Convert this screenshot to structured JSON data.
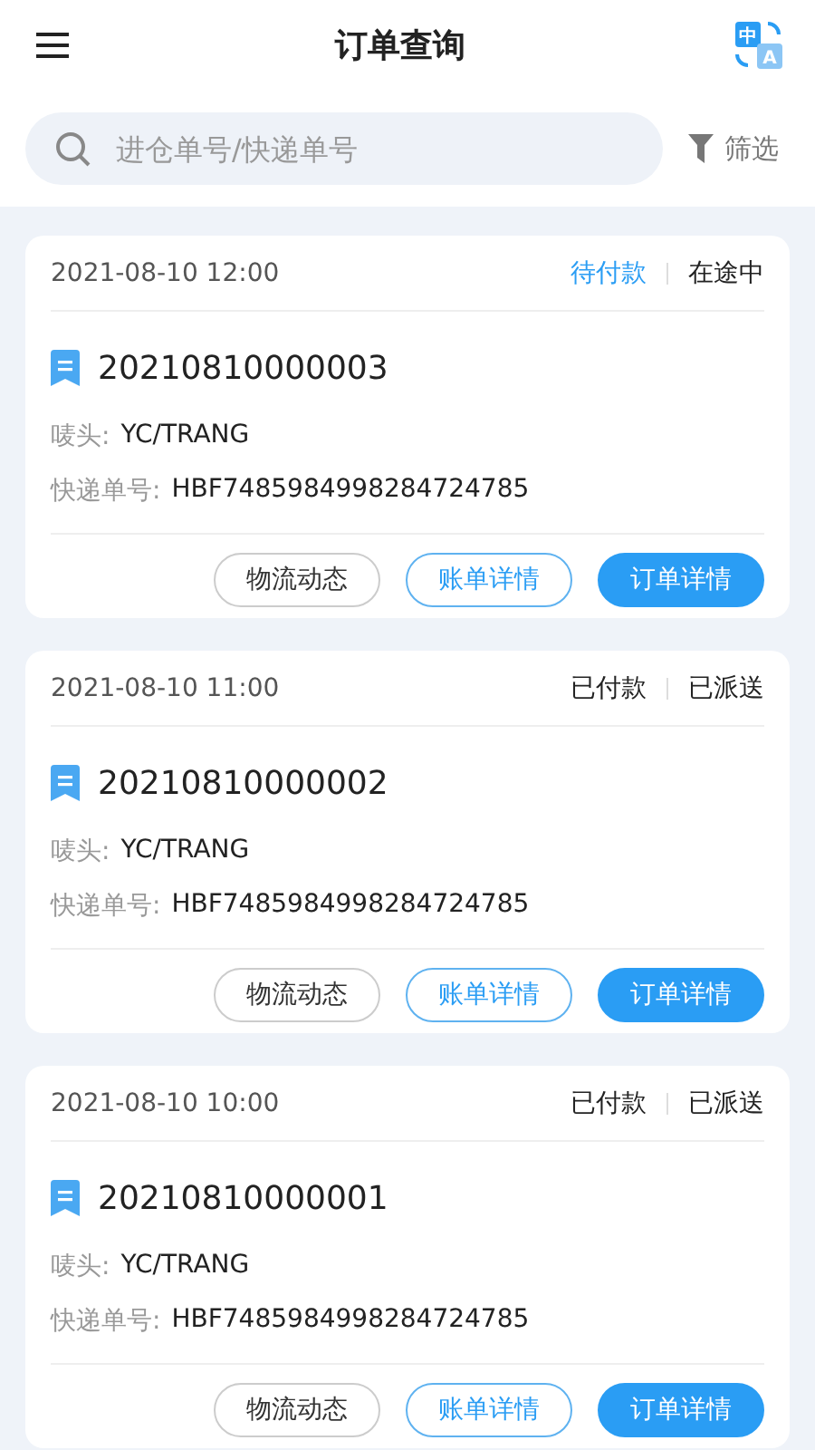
{
  "header": {
    "title": "订单查询",
    "language_icon": {
      "source": "中",
      "target": "A"
    }
  },
  "search": {
    "placeholder": "进仓单号/快递单号"
  },
  "filter": {
    "label": "筛选"
  },
  "orders": [
    {
      "time": "2021-08-10 12:00",
      "payment": {
        "text": "待付款",
        "paid": false
      },
      "shipping": "在途中",
      "number": "20210810000003",
      "mark_label": "唛头:",
      "mark": "YC/TRANG",
      "tracking_label": "快递单号:",
      "tracking": "HBF7485984998284724785",
      "buttons": [
        {
          "label": "物流动态",
          "kind": "plain"
        },
        {
          "label": "账单详情",
          "kind": "outline"
        },
        {
          "label": "订单详情",
          "kind": "primary"
        }
      ]
    },
    {
      "time": "2021-08-10 11:00",
      "payment": {
        "text": "已付款",
        "paid": true
      },
      "shipping": "已派送",
      "number": "20210810000002",
      "mark_label": "唛头:",
      "mark": "YC/TRANG",
      "tracking_label": "快递单号:",
      "tracking": "HBF7485984998284724785",
      "buttons": [
        {
          "label": "物流动态",
          "kind": "plain"
        },
        {
          "label": "账单详情",
          "kind": "outline"
        },
        {
          "label": "订单详情",
          "kind": "primary"
        }
      ]
    },
    {
      "time": "2021-08-10 10:00",
      "payment": {
        "text": "已付款",
        "paid": true
      },
      "shipping": "已派送",
      "number": "20210810000001",
      "mark_label": "唛头:",
      "mark": "YC/TRANG",
      "tracking_label": "快递单号:",
      "tracking": "HBF7485984998284724785",
      "buttons": [
        {
          "label": "物流动态",
          "kind": "plain"
        },
        {
          "label": "账单详情",
          "kind": "outline"
        },
        {
          "label": "订单详情",
          "kind": "primary"
        }
      ]
    }
  ]
}
